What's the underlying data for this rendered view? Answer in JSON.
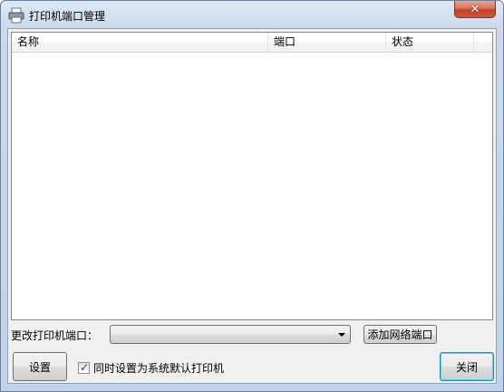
{
  "window": {
    "title": "打印机端口管理",
    "close_glyph": "✕"
  },
  "list": {
    "columns": [
      "名称",
      "端口",
      "状态"
    ],
    "rows": []
  },
  "port": {
    "label": "更改打印机端口：",
    "selected": "",
    "add_button": "添加网络端口"
  },
  "footer": {
    "settings_button": "设置",
    "default_checkbox_label": "同时设置为系统默认打印机",
    "default_checked": true,
    "close_button": "关闭"
  }
}
